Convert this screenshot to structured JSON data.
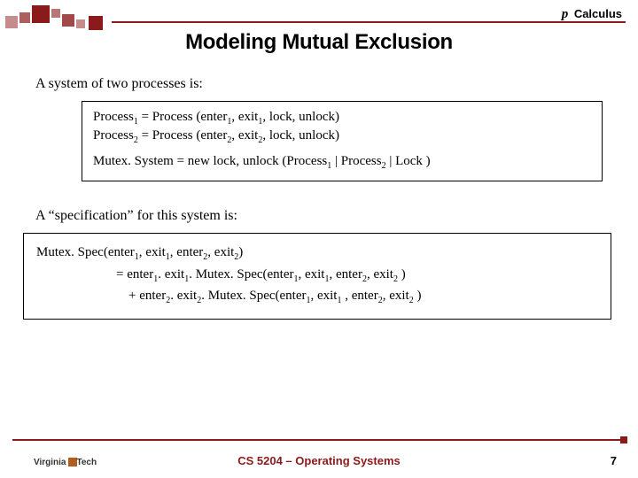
{
  "header": {
    "pi": "p",
    "calculus": " Calculus"
  },
  "title": "Modeling Mutual Exclusion",
  "para1": "A system of two processes is:",
  "box1": {
    "l1a": "Process",
    "l1b": " = Process (enter",
    "l1c": ", exit",
    "l1d": ", lock, unlock)",
    "l2a": "Process",
    "l2b": " = Process (enter",
    "l2c": ", exit",
    "l2d": ", lock, unlock)",
    "l3a": "Mutex. System = new lock, unlock (Process",
    "l3b": " | Process",
    "l3c": " | Lock )"
  },
  "para2": "A “specification” for this system is:",
  "box2": {
    "l1a": "Mutex. Spec(enter",
    "l1b": ", exit",
    "l1c": ", enter",
    "l1d": ", exit",
    "l1e": ")",
    "l2a": "=   enter",
    "l2b": ". exit",
    "l2c": ". Mutex. Spec(enter",
    "l2d": ", exit",
    "l2e": ", enter",
    "l2f": ", exit",
    "l2g": " )",
    "l3a": "+ enter",
    "l3b": ". exit",
    "l3c": ". Mutex. Spec(enter",
    "l3d": ", exit",
    "l3e": " , enter",
    "l3f": ", exit",
    "l3g": " )"
  },
  "sub": {
    "s1": "1",
    "s2": "2"
  },
  "footer": {
    "logo1": "Virginia",
    "logo2": "Tech",
    "center": "CS 5204 – Operating Systems",
    "page": "7"
  }
}
